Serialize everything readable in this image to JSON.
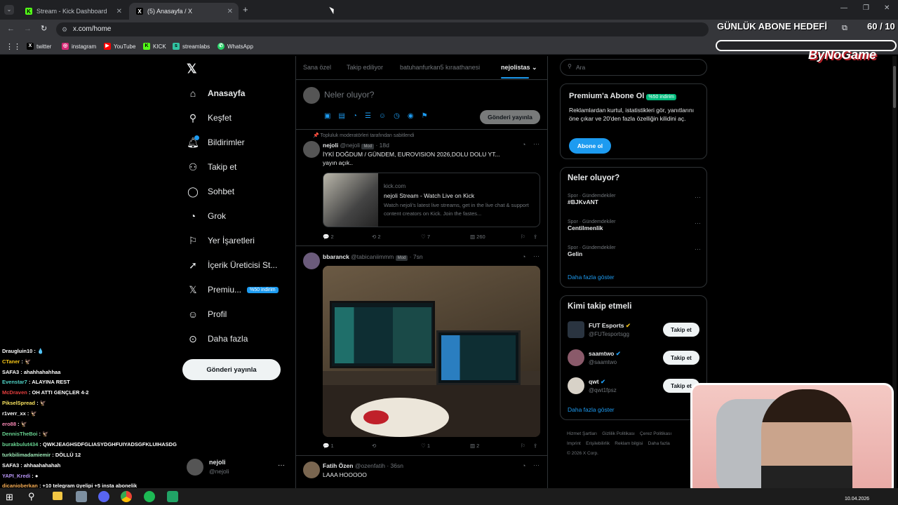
{
  "tabs": [
    {
      "label": "Stream - Kick Dashboard",
      "icon": "kick-icon"
    },
    {
      "label": "(5) Anasayfa / X",
      "icon": "x-logo-icon"
    }
  ],
  "address": "x.com/home",
  "bookmarks": [
    "twitter",
    "instagram",
    "YouTube",
    "KICK",
    "streamlabs",
    "WhatsApp"
  ],
  "overlay": {
    "goal_label": "GÜNLÜK ABONE HEDEFİ",
    "goal_count": "60 / 10",
    "brand": "ByNoGame"
  },
  "nav": {
    "items": [
      {
        "label": "Anasayfa",
        "icon": "home-icon"
      },
      {
        "label": "Keşfet",
        "icon": "search-icon"
      },
      {
        "label": "Bildirimler",
        "icon": "bell-icon"
      },
      {
        "label": "Takip et",
        "icon": "follow-icon"
      },
      {
        "label": "Sohbet",
        "icon": "chat-icon"
      },
      {
        "label": "Grok",
        "icon": "grok-icon"
      },
      {
        "label": "Yer İşaretleri",
        "icon": "bookmark-icon"
      },
      {
        "label": "İçerik Üreticisi St...",
        "icon": "rocket-icon"
      },
      {
        "label": "Premiu...",
        "icon": "x-icon",
        "badge": "%50 indirim"
      },
      {
        "label": "Profil",
        "icon": "person-icon"
      },
      {
        "label": "Daha fazla",
        "icon": "more-icon"
      }
    ],
    "post_button": "Gönderi yayınla",
    "profile_name": "nejoli",
    "profile_handle": "@nejoli"
  },
  "feed": {
    "tabs": [
      "Sana özel",
      "Takip ediliyor",
      "batuhanfurkan5 kıraathanesi",
      "nejolistas"
    ],
    "composer_placeholder": "Neler oluyor?",
    "composer_button": "Gönderi yayınla",
    "pinned_label": "Topluluk moderatörleri tarafından sabitlendi",
    "posts": [
      {
        "name": "nejoli",
        "handle": "@nejoli",
        "badge": "Mod",
        "time": "· 18d",
        "text1": "İYKİ DOĞDUM / GÜNDEM, EUROVISION 2026,DOLU DOLU YT...",
        "text2": "yayın açık..",
        "link_domain": "kick.com",
        "link_title": "nejoli Stream - Watch Live on Kick",
        "link_desc": "Watch nejoli's latest live streams, get in the live chat & support content creators on Kick. Join the fastes...",
        "replies": "2",
        "reposts": "2",
        "likes": "7",
        "views": "260"
      },
      {
        "name": "bbaranck",
        "handle": "@tabicaniimmm",
        "badge": "Mod",
        "time": "· 7sn",
        "replies": "1",
        "likes": "1",
        "views": "2"
      },
      {
        "name": "Fatih Özen",
        "handle": "@ozenfatih",
        "time": "· 36sn",
        "text1": "LAAA HOOOOO"
      }
    ]
  },
  "right": {
    "search_placeholder": "Ara",
    "premium": {
      "title": "Premium'a Abone Ol",
      "badge": "%50 indirim",
      "text": "Reklamlardan kurtul, istatistikleri gör, yanıtlarını öne çıkar ve 20'den fazla özelliğin kilidini aç.",
      "button": "Abone ol"
    },
    "trends": {
      "title": "Neler oluyor?",
      "items": [
        {
          "cat": "Spor · Gündemdekiler",
          "name": "#BJKvANT"
        },
        {
          "cat": "Spor · Gündemdekiler",
          "name": "Centilmenlik"
        },
        {
          "cat": "Spor · Gündemdekiler",
          "name": "Gelin"
        }
      ],
      "more": "Daha fazla göster"
    },
    "who": {
      "title": "Kimi takip etmeli",
      "items": [
        {
          "name": "FUT Esports",
          "handle": "@FUTesportsgg"
        },
        {
          "name": "saamtwo",
          "handle": "@saamtwo"
        },
        {
          "name": "qwt",
          "handle": "@qwt1fpsz"
        }
      ],
      "button": "Takip et",
      "more": "Daha fazla göster"
    },
    "footer1": [
      "Hizmet Şartları",
      "Gizlilik Politikası",
      "Çerez Politikası"
    ],
    "footer2": [
      "Imprint",
      "Erişilebilirlik",
      "Reklam bilgisi",
      "Daha fazla"
    ],
    "copyright": "© 2026 X Corp."
  },
  "chat": [
    {
      "user": "Draugluin10",
      "msg": "💧",
      "color": "#ffffff"
    },
    {
      "user": "CTaner",
      "msg": "🦅",
      "color": "#f5c518"
    },
    {
      "user": "SAFA3",
      "msg": "ahahhahahhaa",
      "color": "#ffffff"
    },
    {
      "user": "Evenstar7",
      "msg": "ALAYINA REST",
      "color": "#4fd1c5"
    },
    {
      "user": "McDraven",
      "msg": "OH ATTI GENÇLER 4-2",
      "color": "#e53e3e"
    },
    {
      "user": "PikselSpread",
      "msg": "🦅",
      "color": "#f6e05e"
    },
    {
      "user": "r1verr_xx",
      "msg": "🦅",
      "color": "#ffffff"
    },
    {
      "user": "ero88",
      "msg": "🦅",
      "color": "#f687b3"
    },
    {
      "user": "DennisTheBoi",
      "msg": "🦅",
      "color": "#68d391"
    },
    {
      "user": "burakbulut434",
      "msg": "QWKJEAGHSDFGLIASYDGHFUIYADSGFKLUIHASDG",
      "color": "#68d391"
    },
    {
      "user": "turkbilimadamiemir",
      "msg": "DÖLLÜ 12",
      "color": "#9ae6b4"
    },
    {
      "user": "SAFA3",
      "msg": "ahhaahahahah",
      "color": "#ffffff"
    },
    {
      "user": "YAPI_Kredi",
      "msg": "●",
      "color": "#b794f4"
    },
    {
      "user": "dicanioberkan",
      "msg": "+10 telegram üyelipi +5 insta abonelik",
      "color": "#f6ad55"
    }
  ],
  "clock": {
    "date": "10.04.2026"
  }
}
